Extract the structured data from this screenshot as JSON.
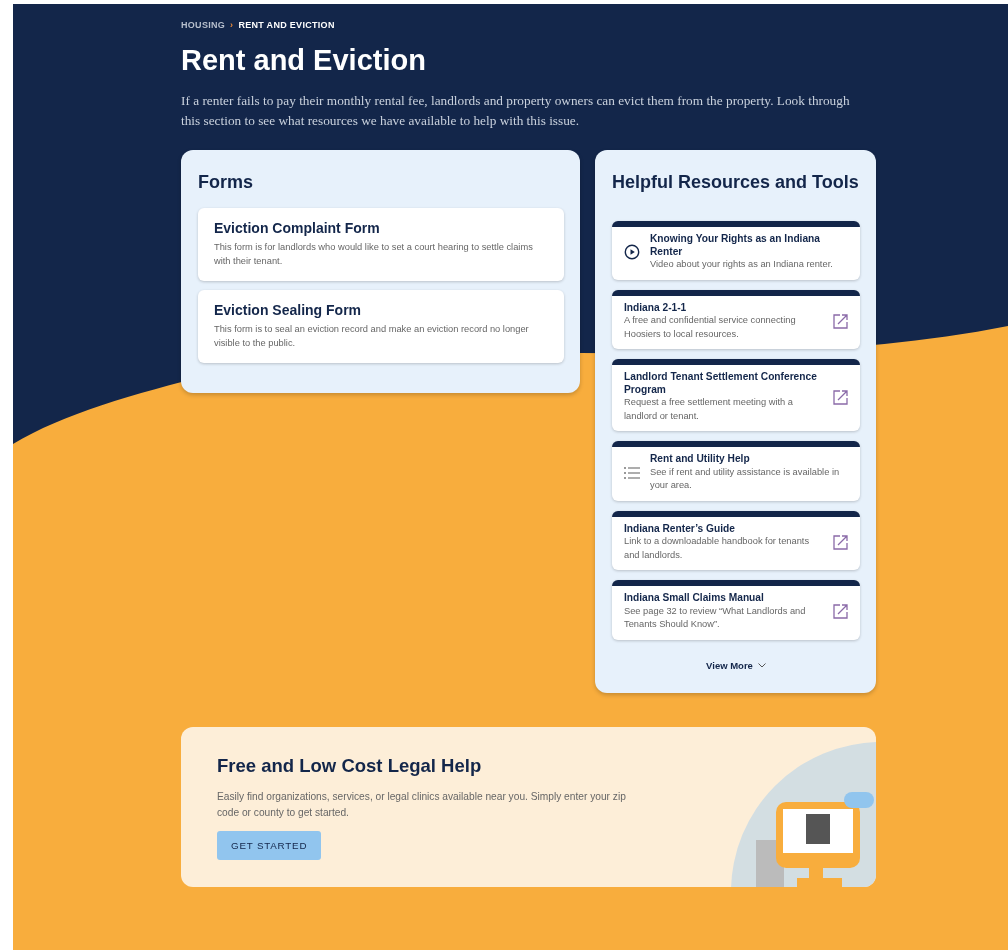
{
  "breadcrumb": [
    {
      "label": "HOUSING",
      "current": false
    },
    {
      "label": "RENT AND EVICTION",
      "current": true
    }
  ],
  "breadcrumb_separator": "›",
  "title": "Rent and Eviction",
  "intro": "If a renter fails to pay their monthly rental fee, landlords and property owners can evict them from the property. Look through this section to see what resources we have available to help with this issue.",
  "forms": {
    "title": "Forms",
    "items": [
      {
        "title": "Eviction Complaint Form",
        "description": "This form is for landlords who would like to set a court hearing to settle claims with their tenant."
      },
      {
        "title": "Eviction Sealing Form",
        "description": "This form is to seal an eviction record and make an eviction record no longer visible to the public."
      }
    ]
  },
  "resources": {
    "title": "Helpful Resources and Tools",
    "items": [
      {
        "kind": "video",
        "title": "Knowing Your Rights as an Indiana Renter",
        "description": "Video about your rights as an Indiana renter."
      },
      {
        "kind": "external",
        "title": "Indiana 2-1-1",
        "description": "A free and confidential service connecting Hoosiers to local resources."
      },
      {
        "kind": "external",
        "title": "Landlord Tenant Settlement Conference Program",
        "description": "Request a free settlement meeting with a landlord or tenant."
      },
      {
        "kind": "list",
        "title": "Rent and Utility Help",
        "description": "See if rent and utility assistance is available in your area."
      },
      {
        "kind": "external",
        "title": "Indiana Renter’s Guide",
        "description": "Link to a downloadable handbook for tenants and landlords."
      },
      {
        "kind": "external",
        "title": "Indiana Small Claims Manual",
        "description": "See page 32 to review “What Landlords and Tenants Should Know”."
      }
    ],
    "view_more": "View More"
  },
  "legal_help": {
    "title": "Free and Low Cost Legal Help",
    "description": "Easily find organizations, services, or legal clinics available near you. Simply enter your zip code or county to get started.",
    "button": "GET STARTED"
  }
}
